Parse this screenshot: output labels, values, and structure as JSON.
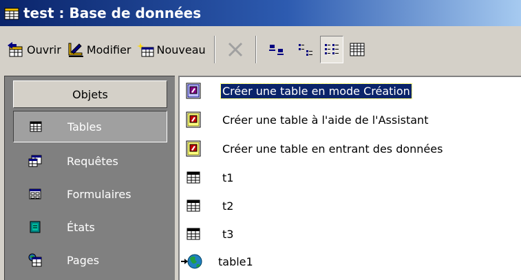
{
  "window": {
    "title": "test : Base de données",
    "icon": "database-window-icon"
  },
  "toolbar": {
    "open_label": "Ouvrir",
    "modify_label": "Modifier",
    "new_label": "Nouveau",
    "delete_icon": "delete-x-icon",
    "large_icons": "large-icons-view-icon",
    "small_icons": "small-icons-view-icon",
    "list_view": "list-view-icon",
    "details_view": "details-view-icon"
  },
  "objects": {
    "header": "Objets",
    "items": [
      {
        "label": "Tables",
        "icon": "table-icon",
        "selected": true
      },
      {
        "label": "Requêtes",
        "icon": "query-icon"
      },
      {
        "label": "Formulaires",
        "icon": "form-icon"
      },
      {
        "label": "États",
        "icon": "report-icon"
      },
      {
        "label": "Pages",
        "icon": "page-icon"
      }
    ]
  },
  "list": {
    "items": [
      {
        "label": "Créer une table en mode Création",
        "icon": "wizard-design-icon",
        "selected": true
      },
      {
        "label": "Créer une table à l'aide de l'Assistant",
        "icon": "wizard-assistant-icon"
      },
      {
        "label": "Créer une table en entrant des données",
        "icon": "wizard-data-entry-icon"
      },
      {
        "label": "t1",
        "icon": "table-icon"
      },
      {
        "label": "t2",
        "icon": "table-icon"
      },
      {
        "label": "t3",
        "icon": "table-icon"
      },
      {
        "label": "table1",
        "icon": "linked-table-globe-icon"
      }
    ]
  },
  "colors": {
    "title_start": "#0a246a",
    "title_end": "#a6caf0",
    "selection": "#0a246a",
    "pane_bg": "#808080"
  }
}
